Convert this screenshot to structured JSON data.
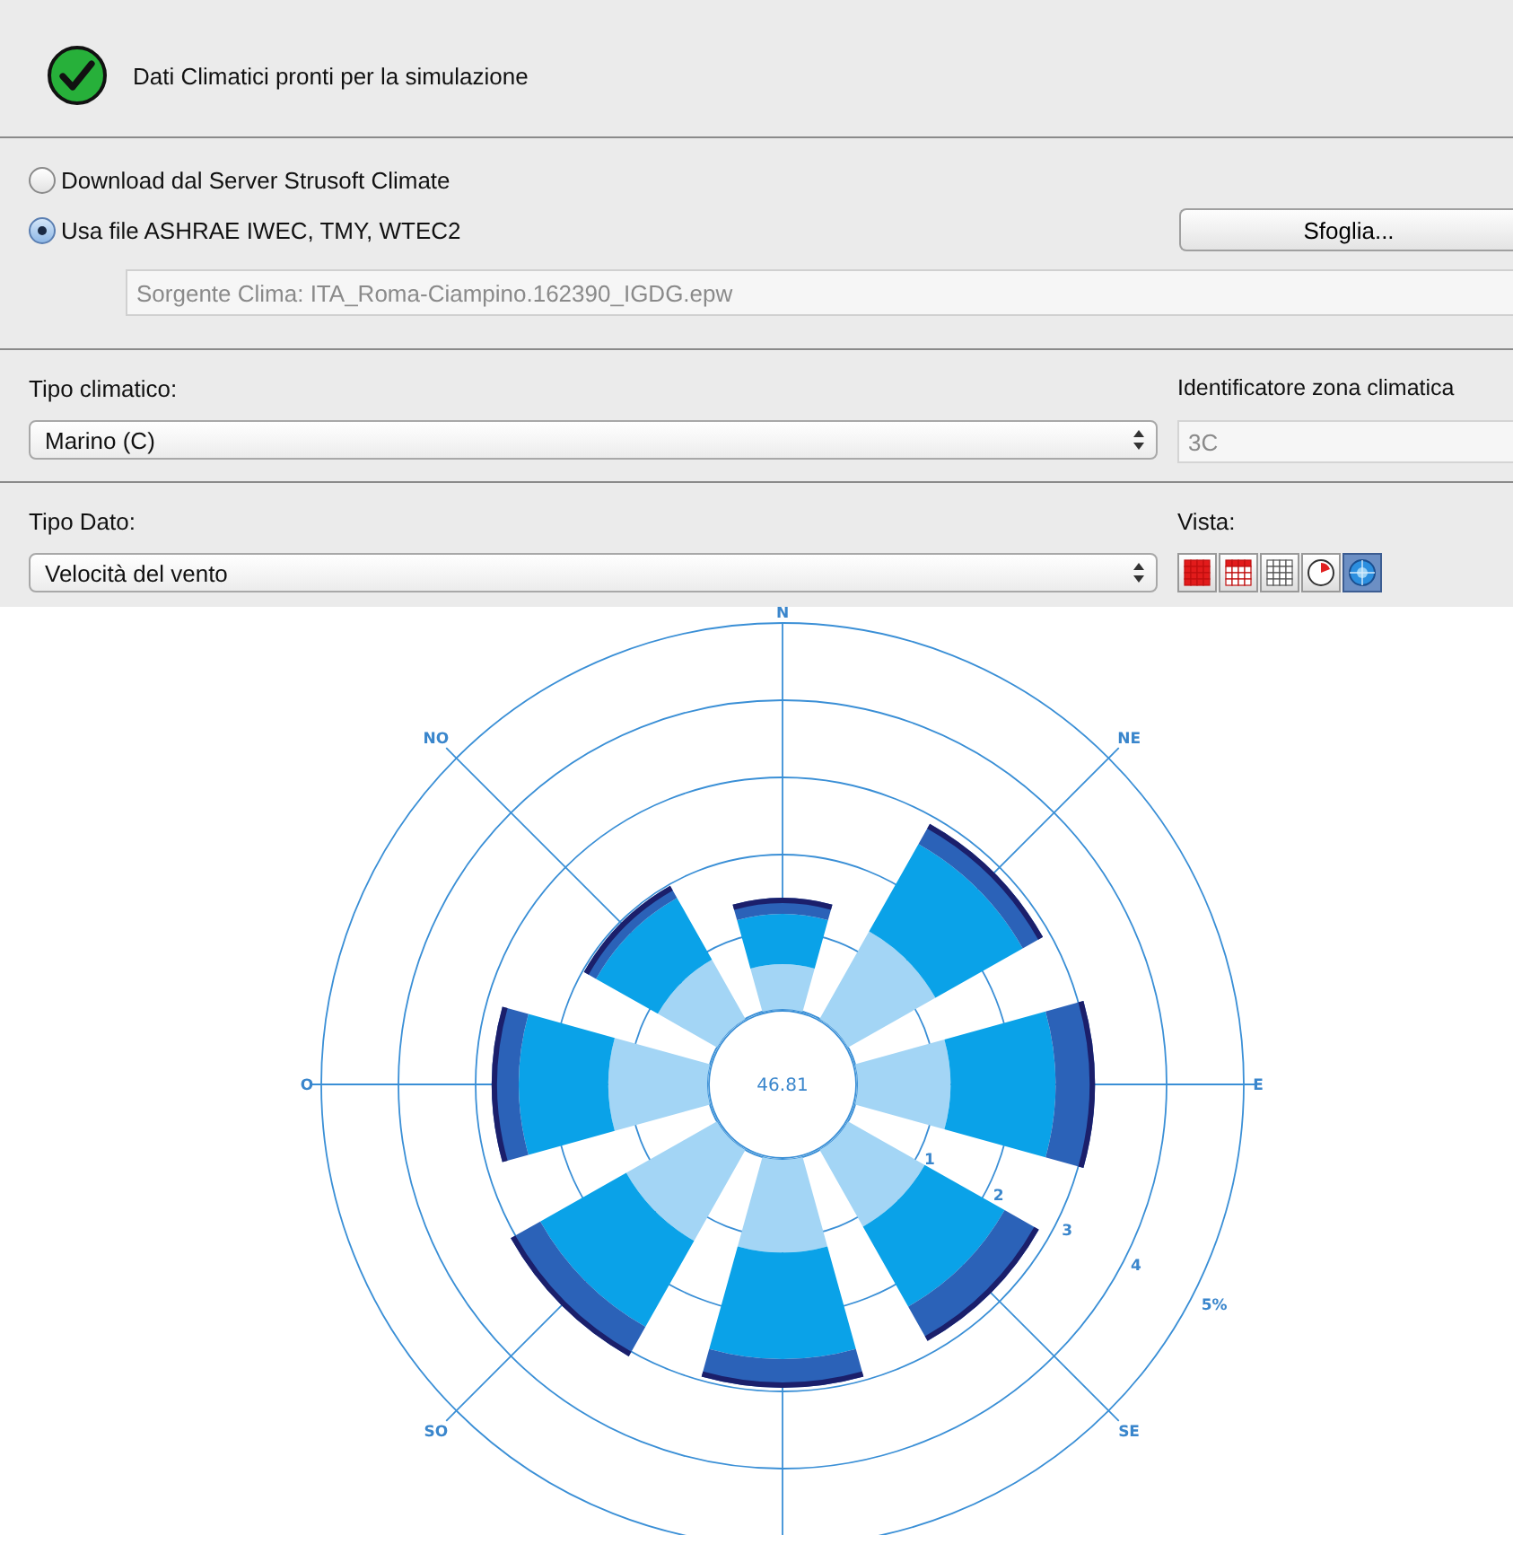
{
  "status": {
    "text": "Dati Climatici pronti per la simulazione",
    "ok": true
  },
  "source_options": [
    {
      "label": "Download dal Server Strusoft Climate",
      "selected": false
    },
    {
      "label": "Usa file ASHRAE IWEC, TMY, WTEC2",
      "selected": true
    }
  ],
  "browse_button": "Sfoglia...",
  "source_field": {
    "value": "Sorgente Clima: ITA_Roma-Ciampino.162390_IGDG.epw",
    "disabled": true
  },
  "climate_type": {
    "label": "Tipo climatico:",
    "value": "Marino (C)"
  },
  "climate_zone": {
    "label": "Identificatore zona climatica",
    "value": "3C",
    "disabled": true
  },
  "data_type": {
    "label": "Tipo Dato:",
    "value": "Velocità del vento"
  },
  "view": {
    "label": "Vista:",
    "buttons": [
      {
        "kind": "grid-red",
        "selected": false
      },
      {
        "kind": "grid-mixed",
        "selected": false
      },
      {
        "kind": "grid-plain",
        "selected": false
      },
      {
        "kind": "clock",
        "selected": false
      },
      {
        "kind": "rose",
        "selected": true
      }
    ]
  },
  "wind_rose": {
    "directions": [
      "N",
      "NE",
      "E",
      "SE",
      "SO",
      "O",
      "NO"
    ],
    "ring_labels": [
      "1",
      "2",
      "3",
      "4",
      "5%"
    ],
    "center_value": "46.81"
  }
}
